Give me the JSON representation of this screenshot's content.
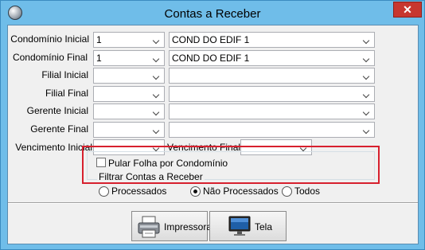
{
  "window": {
    "title": "Contas a Receber",
    "close_label": "✕"
  },
  "fields": {
    "condominio_inicial": {
      "label": "Condomínio Inicial",
      "code": "1",
      "name": "COND DO EDIF 1"
    },
    "condominio_final": {
      "label": "Condomínio Final",
      "code": "1",
      "name": "COND DO EDIF 1"
    },
    "filial_inicial": {
      "label": "Filial Inicial",
      "code": "",
      "name": ""
    },
    "filial_final": {
      "label": "Filial Final",
      "code": "",
      "name": ""
    },
    "gerente_inicial": {
      "label": "Gerente Inicial",
      "code": "",
      "name": ""
    },
    "gerente_final": {
      "label": "Gerente Final",
      "code": "",
      "name": ""
    },
    "vencimento_inicial": {
      "label": "Vencimento Inicial",
      "value": ""
    },
    "vencimento_final": {
      "label": "Vencimento Final",
      "value": ""
    }
  },
  "pular_folha": {
    "label": "Pular Folha por Condomínio",
    "checked": false
  },
  "filtro": {
    "title": "Filtrar Contas a Receber",
    "options": [
      {
        "label": "Processados",
        "checked": false
      },
      {
        "label": "Não Processados",
        "checked": true
      },
      {
        "label": "Todos",
        "checked": false
      }
    ]
  },
  "buttons": {
    "impressora": "Impressora",
    "tela": "Tela"
  },
  "colors": {
    "title_bar": "#6fbde9",
    "close": "#c7372f",
    "highlight": "#d7202e"
  },
  "icons": {
    "app": "app-icon",
    "printer": "printer-icon",
    "monitor": "monitor-icon"
  }
}
